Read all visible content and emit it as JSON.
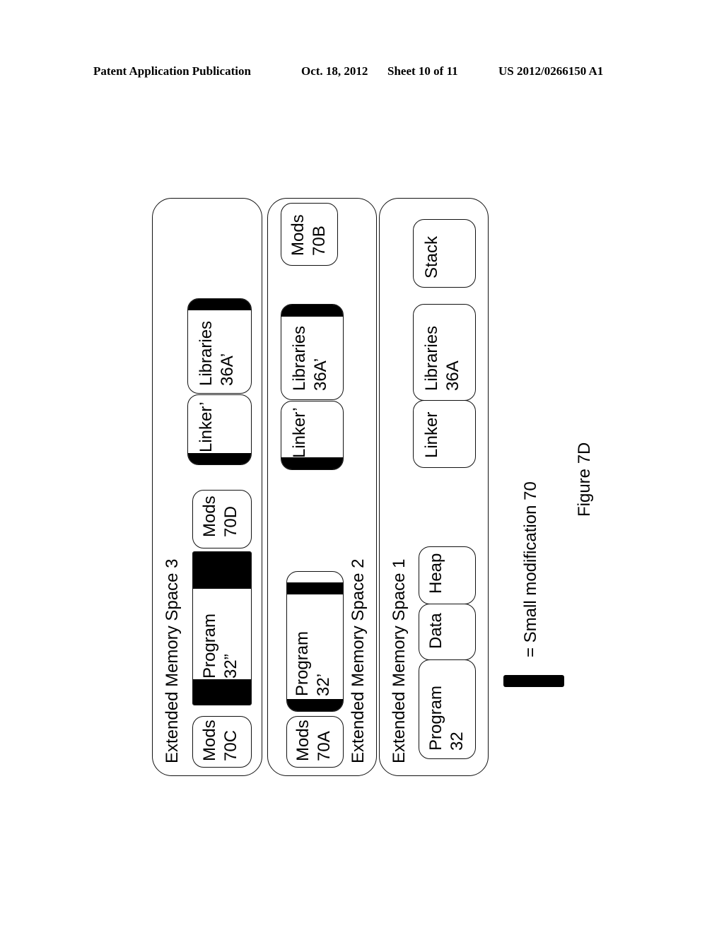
{
  "header": {
    "publication": "Patent Application Publication",
    "date": "Oct. 18, 2012",
    "sheet": "Sheet 10 of 11",
    "number": "US 2012/0266150 A1"
  },
  "spaces": [
    {
      "title": "Extended Memory Space 3",
      "blocks": [
        {
          "line1": "Mods",
          "line2": "70C",
          "modified": false
        },
        {
          "line1": "Program",
          "line2": "32”",
          "modified": true
        },
        {
          "line1": "Mods",
          "line2": "70D",
          "modified": false
        },
        {
          "line1": "Linker’",
          "line2": "",
          "modified": true
        },
        {
          "line1": "Libraries",
          "line2": "36A’",
          "modified": true
        }
      ]
    },
    {
      "title": "Extended Memory Space 2",
      "blocks": [
        {
          "line1": "Mods",
          "line2": "70A",
          "modified": false
        },
        {
          "line1": "Program",
          "line2": "32’",
          "modified": true
        },
        {
          "line1": "Linker’",
          "line2": "",
          "modified": true
        },
        {
          "line1": "Libraries",
          "line2": "36A’",
          "modified": true
        },
        {
          "line1": "Mods",
          "line2": "70B",
          "modified": false
        }
      ]
    },
    {
      "title": "Extended Memory Space 1",
      "blocks": [
        {
          "line1": "Program",
          "line2": "32",
          "modified": false
        },
        {
          "line1": "Data",
          "line2": "",
          "modified": false
        },
        {
          "line1": "Heap",
          "line2": "",
          "modified": false
        },
        {
          "line1": "Linker",
          "line2": "",
          "modified": false
        },
        {
          "line1": "Libraries",
          "line2": "36A",
          "modified": false
        },
        {
          "line1": "Stack",
          "line2": "",
          "modified": false
        }
      ]
    }
  ],
  "legend": {
    "text": "= Small modification 70"
  },
  "figure_label": "Figure 7D"
}
